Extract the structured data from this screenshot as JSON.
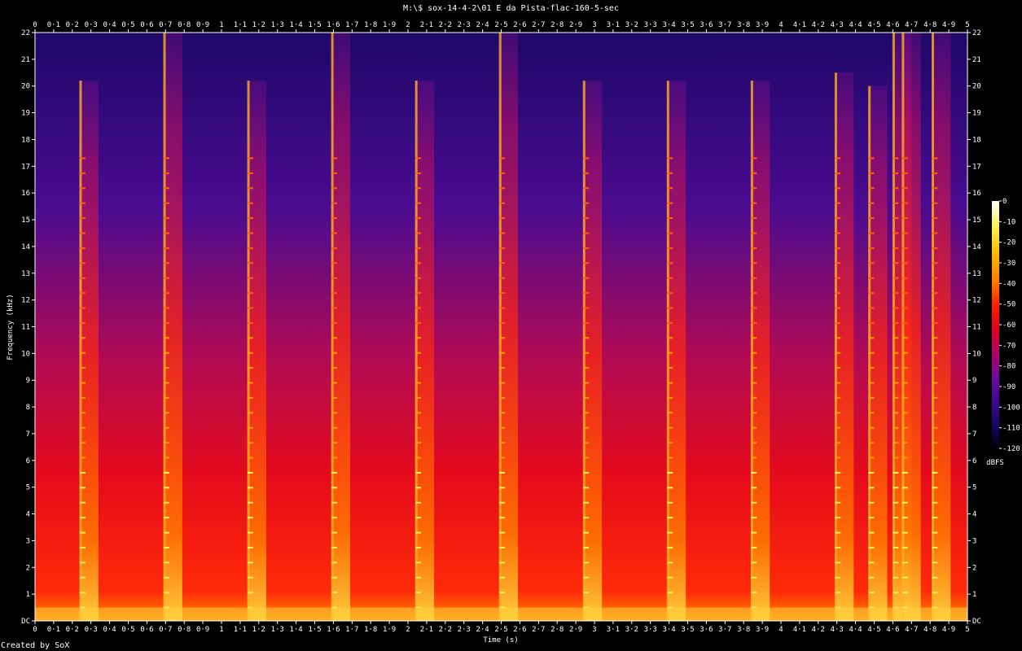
{
  "chart_data": {
    "type": "heatmap",
    "title": "M:\\$ sox-14-4-2\\01 E da Pista-flac-160-5-sec",
    "xlabel": "Time (s)",
    "ylabel": "Frequency (kHz)",
    "xlim": [
      0,
      5
    ],
    "ylim": [
      0,
      22
    ],
    "x_ticks": [
      "0",
      "0·1",
      "0·2",
      "0·3",
      "0·4",
      "0·5",
      "0·6",
      "0·7",
      "0·8",
      "0·9",
      "1",
      "1·1",
      "1·2",
      "1·3",
      "1·4",
      "1·5",
      "1·6",
      "1·7",
      "1·8",
      "1·9",
      "2",
      "2·1",
      "2·2",
      "2·3",
      "2·4",
      "2·5",
      "2·6",
      "2·7",
      "2·8",
      "2·9",
      "3",
      "3·1",
      "3·2",
      "3·3",
      "3·4",
      "3·5",
      "3·6",
      "3·7",
      "3·8",
      "3·9",
      "4",
      "4·1",
      "4·2",
      "4·3",
      "4·4",
      "4·5",
      "4·6",
      "4·7",
      "4·8",
      "4·9",
      "5"
    ],
    "y_ticks": [
      "DC",
      "1",
      "2",
      "3",
      "4",
      "5",
      "6",
      "7",
      "8",
      "9",
      "10",
      "11",
      "12",
      "13",
      "14",
      "15",
      "16",
      "17",
      "18",
      "19",
      "20",
      "21",
      "22"
    ],
    "colorbar": {
      "label": "dBFS",
      "range": [
        -120,
        0
      ],
      "ticks": [
        "0",
        "-10",
        "-20",
        "-30",
        "-40",
        "-50",
        "-60",
        "-70",
        "-80",
        "-90",
        "-100",
        "-110",
        "-120"
      ],
      "colors": [
        "#ffffff",
        "#fff25a",
        "#ffc000",
        "#ff8000",
        "#ff2000",
        "#e00020",
        "#b0006a",
        "#6a0aa0",
        "#360a90",
        "#14045c",
        "#000000"
      ]
    },
    "transient_onsets_s": [
      0.24,
      0.69,
      1.14,
      1.59,
      2.04,
      2.49,
      2.94,
      3.39,
      3.84,
      4.29,
      4.47,
      4.6,
      4.65,
      4.81
    ],
    "transient_peak_khz": [
      20.2,
      22,
      20.2,
      22,
      20.2,
      22,
      20.2,
      20.2,
      20.2,
      20.5,
      20,
      22,
      22,
      22
    ]
  },
  "credit": "Created by SoX",
  "colors": {
    "background": "#000000",
    "axis": "#ffffff"
  }
}
